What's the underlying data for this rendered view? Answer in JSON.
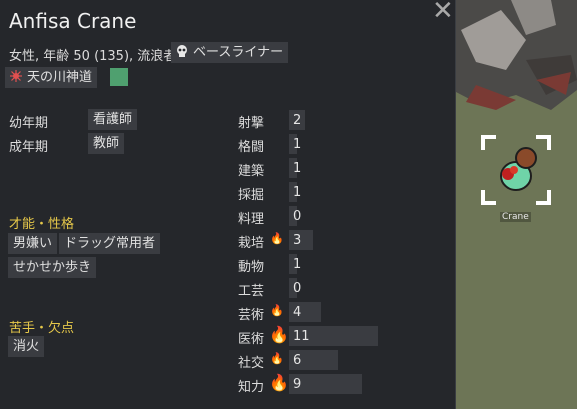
{
  "pawn": {
    "name": "Anfisa Crane",
    "description": "女性, 年齢 50 (135), 流浪者",
    "xenotype": "ベースライナー",
    "ideology": "天の川神道",
    "ideology_color": "#4fa06f"
  },
  "backstory": {
    "childhood_label": "幼年期",
    "childhood_value": "看護師",
    "adulthood_label": "成年期",
    "adulthood_value": "教師"
  },
  "traits": {
    "header": "才能・性格",
    "items": [
      "男嫌い",
      "ドラッグ常用者",
      "せかせか歩き"
    ]
  },
  "incapable": {
    "header": "苦手・欠点",
    "items": [
      "消火"
    ]
  },
  "skills": [
    {
      "name": "射撃",
      "level": 2,
      "passion": "none"
    },
    {
      "name": "格闘",
      "level": 1,
      "passion": "none"
    },
    {
      "name": "建築",
      "level": 1,
      "passion": "none"
    },
    {
      "name": "採掘",
      "level": 1,
      "passion": "none"
    },
    {
      "name": "料理",
      "level": 0,
      "passion": "none"
    },
    {
      "name": "栽培",
      "level": 3,
      "passion": "minor"
    },
    {
      "name": "動物",
      "level": 1,
      "passion": "none"
    },
    {
      "name": "工芸",
      "level": 0,
      "passion": "none"
    },
    {
      "name": "芸術",
      "level": 4,
      "passion": "minor"
    },
    {
      "name": "医術",
      "level": 11,
      "passion": "major"
    },
    {
      "name": "社交",
      "level": 6,
      "passion": "minor"
    },
    {
      "name": "知力",
      "level": 9,
      "passion": "major"
    }
  ],
  "map": {
    "pawn_label": "Crane"
  },
  "icons": {
    "close": "close-icon",
    "xenotype": "skull-icon",
    "ideology": "ideology-symbol-icon",
    "passion": "flame-icon"
  }
}
